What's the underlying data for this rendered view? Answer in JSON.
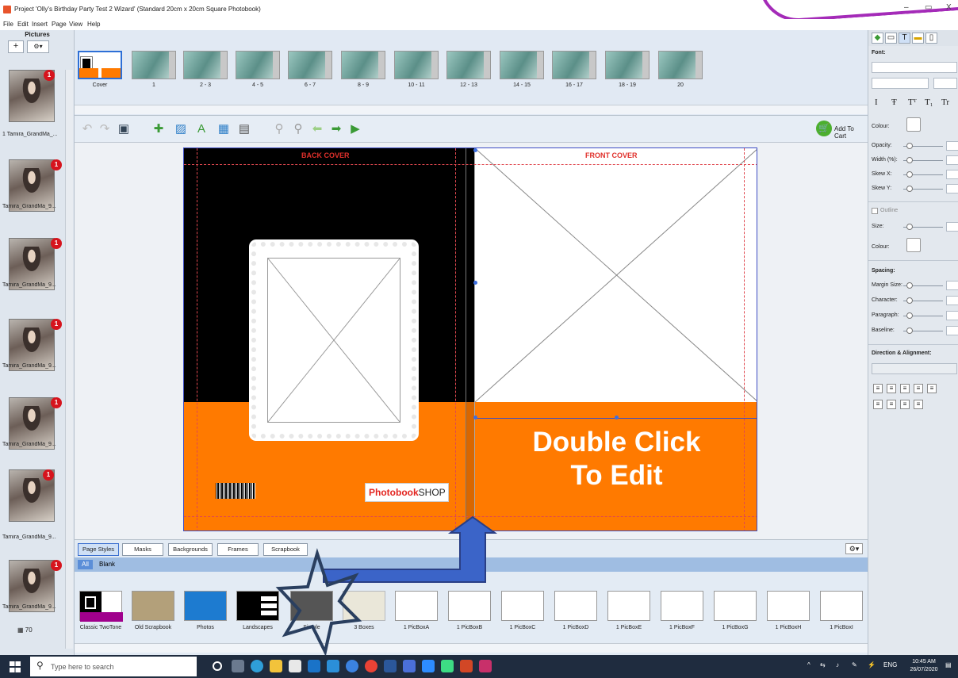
{
  "window": {
    "title": "Project 'Olly's Birthday Party Test 2 Wizard' (Standard 20cm x 20cm Square Photobook)",
    "minimize": "–",
    "maximize": "▭",
    "close": "X"
  },
  "menu": [
    "File",
    "Edit",
    "Insert",
    "Page",
    "View",
    "Help"
  ],
  "pictures_panel": {
    "title": "Pictures",
    "add_button": "+",
    "settings_button": "⚙▾",
    "items": [
      {
        "label": "1 Tamira_GrandMa_...",
        "badge": "1"
      },
      {
        "label": "Tamira_GrandMa_9...",
        "badge": "1"
      },
      {
        "label": "Tamira_GrandMa_9...",
        "badge": "1"
      },
      {
        "label": "Tamira_GrandMa_9...",
        "badge": "1"
      },
      {
        "label": "Tamira_GrandMa_9...",
        "badge": "1"
      },
      {
        "label": "Tamira_GrandMa_9...",
        "badge": "1"
      },
      {
        "label": "Tamira_GrandMa_9...",
        "badge": "1"
      }
    ],
    "count": "70"
  },
  "page_thumbnails": [
    "Cover",
    "1",
    "2 - 3",
    "4 - 5",
    "6 - 7",
    "8 - 9",
    "10 - 11",
    "12 - 13",
    "14 - 15",
    "16 - 17",
    "18 - 19",
    "20"
  ],
  "toolbar": {
    "icons": [
      "undo-icon",
      "redo-icon",
      "save-icon",
      "add-page-icon",
      "auto-fill-icon",
      "add-text-icon",
      "add-picture-icon",
      "page-setup-icon",
      "zoom-in-icon",
      "zoom-out-icon",
      "previous-page-icon",
      "next-page-icon",
      "play-icon"
    ],
    "add_to_cart": "Add To Cart"
  },
  "spread": {
    "back_cover_label": "BACK COVER",
    "front_cover_label": "FRONT COVER",
    "front_text_line1": "Double Click",
    "front_text_line2": "To Edit",
    "logo_bold": "Photobook",
    "logo_rest": "SHOP",
    "colors": {
      "back": "#000000",
      "band": "#ff7a00",
      "label": "#e0302b"
    }
  },
  "bottom_tabs": [
    "Page Styles",
    "Masks",
    "Backgrounds",
    "Frames",
    "Scrapbook"
  ],
  "filters": [
    "All",
    "Blank"
  ],
  "page_styles": [
    "Classic TwoTone",
    "Old Scrapbook",
    "Photos",
    "Landscapes",
    "Simple",
    "3 Boxes",
    "1 PicBoxA",
    "1 PicBoxB",
    "1 PicBoxC",
    "1 PicBoxD",
    "1 PicBoxE",
    "1 PicBoxF",
    "1 PicBoxG",
    "1 PicBoxH",
    "1 PicBoxI"
  ],
  "right_panel": {
    "tabs": [
      "colour-icon",
      "frame-icon",
      "T",
      "ruler-icon",
      "page-icon"
    ],
    "font_label": "Font:",
    "format_buttons": [
      "I",
      "Ŧ",
      "Tᵀ",
      "T₁",
      "Tr"
    ],
    "colour_label": "Colour:",
    "opacity_label": "Opacity:",
    "width_label": "Width (%):",
    "skewx_label": "Skew X:",
    "skewy_label": "Skew Y:",
    "outline_label": "Outline",
    "size_label": "Size:",
    "outline_colour_label": "Colour:",
    "spacing_label": "Spacing:",
    "margin_label": "Margin Size:",
    "character_label": "Character:",
    "paragraph_label": "Paragraph:",
    "baseline_label": "Baseline:",
    "direction_label": "Direction & Alignment:"
  },
  "taskbar": {
    "search_placeholder": "Type here to search",
    "language": "ENG",
    "time": "10:45 AM",
    "date": "26/07/2020"
  }
}
